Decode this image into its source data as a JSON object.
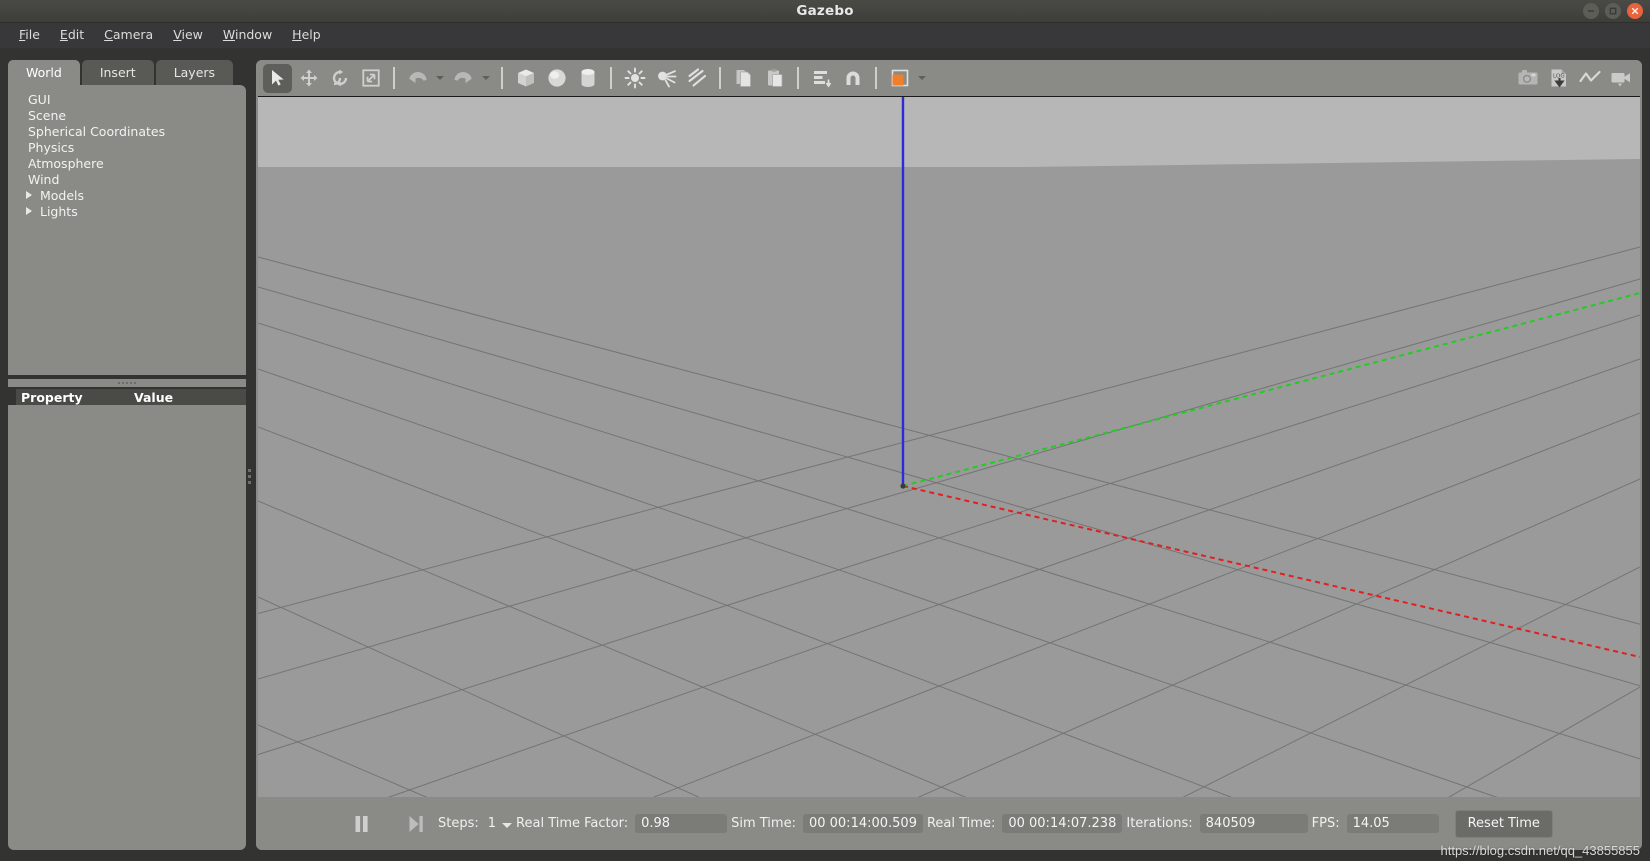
{
  "window": {
    "title": "Gazebo",
    "controls": [
      {
        "name": "minimize",
        "glyph": "—"
      },
      {
        "name": "maximize",
        "glyph": "□"
      },
      {
        "name": "close",
        "glyph": "✕"
      }
    ],
    "close_color": "#e8643c"
  },
  "menubar": {
    "items": [
      {
        "label": "File",
        "mnemonic": "F"
      },
      {
        "label": "Edit",
        "mnemonic": "E"
      },
      {
        "label": "Camera",
        "mnemonic": "C"
      },
      {
        "label": "View",
        "mnemonic": "V"
      },
      {
        "label": "Window",
        "mnemonic": "W"
      },
      {
        "label": "Help",
        "mnemonic": "H"
      }
    ]
  },
  "left_panel": {
    "tabs": [
      {
        "label": "World",
        "active": true
      },
      {
        "label": "Insert",
        "active": false
      },
      {
        "label": "Layers",
        "active": false
      }
    ],
    "tree": [
      {
        "label": "GUI",
        "expandable": false
      },
      {
        "label": "Scene",
        "expandable": false
      },
      {
        "label": "Spherical Coordinates",
        "expandable": false
      },
      {
        "label": "Physics",
        "expandable": false
      },
      {
        "label": "Atmosphere",
        "expandable": false
      },
      {
        "label": "Wind",
        "expandable": false
      },
      {
        "label": "Models",
        "expandable": true
      },
      {
        "label": "Lights",
        "expandable": true
      }
    ],
    "property_table": {
      "columns": [
        "Property",
        "Value"
      ],
      "rows": []
    }
  },
  "toolbar": {
    "left_tools": [
      {
        "name": "select-mode",
        "icon": "cursor-arrow-icon",
        "pressed": true
      },
      {
        "name": "translate-mode",
        "icon": "move-arrows-icon",
        "pressed": false
      },
      {
        "name": "rotate-mode",
        "icon": "rotate-icon",
        "pressed": false
      },
      {
        "name": "scale-mode",
        "icon": "scale-icon",
        "pressed": false
      },
      {
        "name": "undo",
        "icon": "undo-arrow-icon",
        "pressed": false
      },
      {
        "name": "redo",
        "icon": "redo-arrow-icon",
        "pressed": false
      },
      {
        "name": "insert-box",
        "icon": "box-icon",
        "pressed": false
      },
      {
        "name": "insert-sphere",
        "icon": "sphere-icon",
        "pressed": false
      },
      {
        "name": "insert-cylinder",
        "icon": "cylinder-icon",
        "pressed": false
      },
      {
        "name": "insert-point-light",
        "icon": "point-light-icon",
        "pressed": false
      },
      {
        "name": "insert-spot-light",
        "icon": "spot-light-icon",
        "pressed": false
      },
      {
        "name": "insert-directional-light",
        "icon": "directional-light-icon",
        "pressed": false
      },
      {
        "name": "copy",
        "icon": "copy-icon",
        "pressed": false
      },
      {
        "name": "paste",
        "icon": "paste-icon",
        "pressed": false
      },
      {
        "name": "align",
        "icon": "align-icon",
        "pressed": false
      },
      {
        "name": "snap",
        "icon": "magnet-snap-icon",
        "pressed": false
      },
      {
        "name": "change-view",
        "icon": "view-orientation-icon",
        "pressed": false
      }
    ],
    "right_tools": [
      {
        "name": "screenshot",
        "icon": "camera-icon"
      },
      {
        "name": "log-record",
        "icon": "log-download-icon",
        "label": "LOG"
      },
      {
        "name": "plot",
        "icon": "plot-line-icon"
      },
      {
        "name": "video-record",
        "icon": "video-camera-icon"
      }
    ],
    "accent_color": "#ef8029"
  },
  "viewport": {
    "sky_color": "#b7b7b7",
    "ground_color": "#9a9a9a",
    "grid_color": "#6e6e6e",
    "axes": [
      {
        "name": "z-axis",
        "color": "#2b2bdd"
      },
      {
        "name": "y-axis",
        "color": "#22cc22"
      },
      {
        "name": "x-axis",
        "color": "#e02020"
      }
    ]
  },
  "statusbar": {
    "pause_button": "pause-icon",
    "step_button": "step-forward-icon",
    "steps_label": "Steps:",
    "steps_value": "1",
    "real_time_factor_label": "Real Time Factor:",
    "real_time_factor_value": "0.98",
    "sim_time_label": "Sim Time:",
    "sim_time_value": "00 00:14:00.509",
    "real_time_label": "Real Time:",
    "real_time_value": "00 00:14:07.238",
    "iterations_label": "Iterations:",
    "iterations_value": "840509",
    "fps_label": "FPS:",
    "fps_value": "14.05",
    "reset_time_label": "Reset Time"
  },
  "watermark": "https://blog.csdn.net/qq_43855855"
}
